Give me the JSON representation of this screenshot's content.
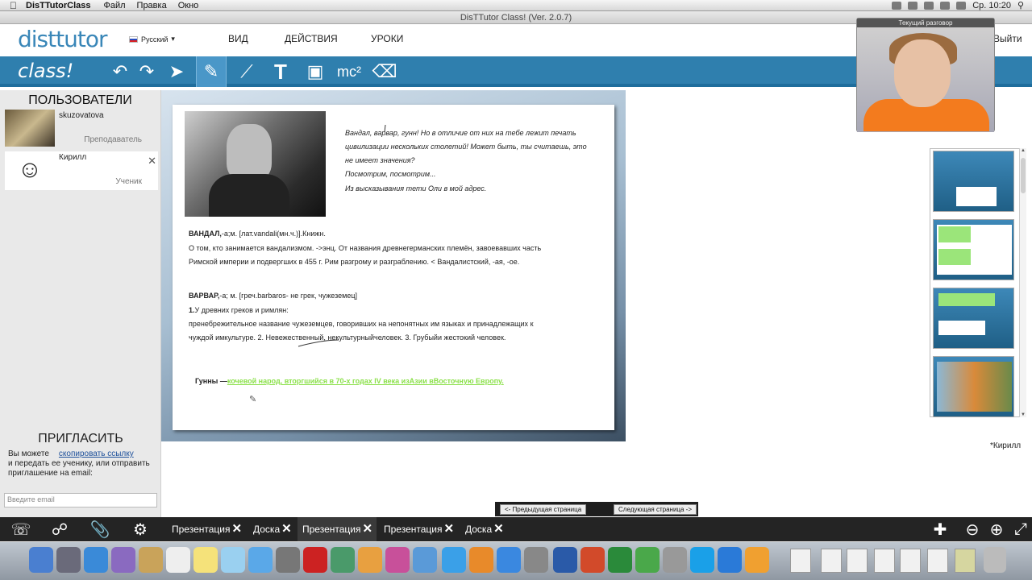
{
  "menubar": {
    "app": "DisTTutorClass",
    "menus": [
      "Файл",
      "Правка",
      "Окно"
    ],
    "clock": "Ср. 10:20"
  },
  "window": {
    "title": "DisTTutor Class! (Ver. 2.0.7)"
  },
  "header": {
    "logo": "disttutor",
    "language": "Русский",
    "nav": [
      "ВИД",
      "ДЕЙСТВИЯ",
      "УРОКИ"
    ],
    "logout": "Выйти"
  },
  "toolbar": {
    "logo": "class!",
    "formula_label": "mc²",
    "icons": [
      "undo-icon",
      "redo-icon",
      "pointer-icon",
      "pencil-icon",
      "line-icon",
      "text-icon",
      "image-icon",
      "formula-icon",
      "eraser-icon"
    ],
    "active_tool": "pencil"
  },
  "users": {
    "title": "ПОЛЬЗОВАТЕЛИ",
    "list": [
      {
        "name": "skuzovatova",
        "role": "Преподаватель"
      },
      {
        "name": "Кирилл",
        "role": "Ученик"
      }
    ]
  },
  "invite": {
    "title": "ПРИГЛАСИТЬ",
    "text1": "Вы можете",
    "link": "скопировать ссылку",
    "text2": "и передать ее ученику, или отправить приглашение на email:",
    "email_placeholder": "Введите email"
  },
  "board": {
    "quote": [
      "Вандал, варвар, гунн! Но в отличие от них на тебе лежит печать",
      "цивилизации нескольких столетий! Может быть, ты считаешь, это",
      "не имеет значения?",
      "Посмотрим, посмотрим...",
      "Из высказывания тети Оли в мой адрес."
    ],
    "vandal_head": "ВАНДАЛ,",
    "vandal_rest": "-а;м. [лат.vandali(мн.ч.)].Книжн.",
    "vandal_lines": [
      "О том, кто занимается вандализмом. ->энц. От названия древнегерманских племён, завоевавших часть",
      "Римской империи и подвергших в 455 г. Рим разгрому и разграблению. < Вандалистский, -ая, -ое."
    ],
    "barbar_head": "ВАРВАР,",
    "barbar_rest": "-а; м. [греч.barbaros- не грек, чужеземец]",
    "barbar_num": "1.",
    "barbar_lines": [
      "У древних греков и римлян:",
      "пренебрежительное название чужеземцев, говоривших на непонятных им языках и принадлежащих к",
      "чуждой имкультуре. 2. Невежественный, некультурныйчеловек. 3. Грубыйи жестокий человек."
    ],
    "hun_head": "Гунны —",
    "hun_text": "кочевой народ, вторгшийся в 70-х годах IV века изАзии вВосточную Европу."
  },
  "video": {
    "caption": "Текущий разговор"
  },
  "right": {
    "user_marker": "*Кирилл"
  },
  "pager": {
    "prev": "<- Предыдущая страница",
    "next": "Следующая страница ->"
  },
  "tabs": [
    {
      "label": "Презентация",
      "active": false
    },
    {
      "label": "Доска",
      "active": false
    },
    {
      "label": "Презентация",
      "active": true
    },
    {
      "label": "Презентация",
      "active": false
    },
    {
      "label": "Доска",
      "active": false
    }
  ],
  "bottom_icons": [
    "chat-icon",
    "share-icon",
    "attach-icon",
    "settings-icon",
    "grid-add-icon",
    "zoom-out-icon",
    "zoom-in-icon",
    "fullscreen-icon"
  ],
  "colors": {
    "toolbar": "#2f7fae",
    "highlight": "#8be04a",
    "bottom": "#242424"
  }
}
